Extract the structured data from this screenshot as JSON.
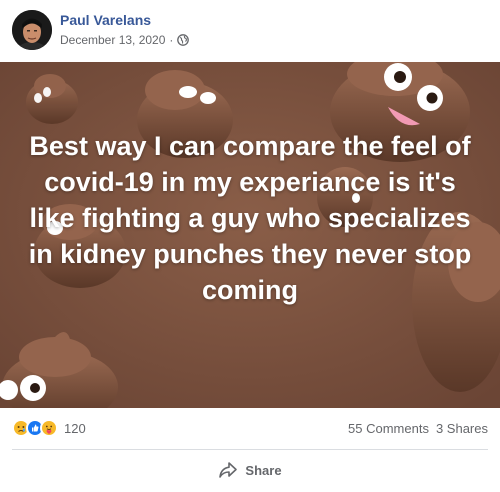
{
  "post": {
    "author": "Paul Varelans",
    "date": "December 13, 2020",
    "date_separator": "·",
    "privacy_icon": "globe-icon",
    "image_text": "Best way I can compare the feel of covid-19 in my experiance is it's like fighting a guy who specializes in kidney punches they never stop coming",
    "reaction_icons": [
      "sad-reaction-icon",
      "like-reaction-icon",
      "care-reaction-icon"
    ],
    "reaction_count": "120",
    "comments": "55 Comments",
    "shares": "3 Shares",
    "share_label": "Share"
  },
  "colors": {
    "author_link": "#385898",
    "meta_text": "#65676b",
    "image_background": "#7a5340",
    "like_blue": "#1877f2",
    "sad_yellow": "#f7b928"
  }
}
